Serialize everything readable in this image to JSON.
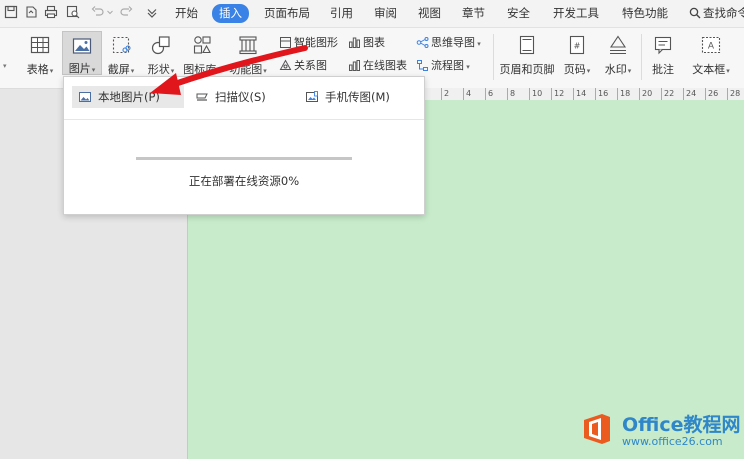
{
  "menu": {
    "tabs": [
      "开始",
      "插入",
      "页面布局",
      "引用",
      "审阅",
      "视图",
      "章节",
      "安全",
      "开发工具",
      "特色功能"
    ],
    "active_tab": "插入",
    "search_label": "查找命令"
  },
  "ribbon": {
    "table_label": "表格",
    "picture_label": "图片",
    "screenshot_label": "截屏",
    "shapes_label": "形状",
    "icons_label": "图标库",
    "function_label": "功能图",
    "smart_graphic": "智能图形",
    "chart": "图表",
    "mindmap": "思维导图",
    "relation": "关系图",
    "online_chart": "在线图表",
    "flowchart": "流程图",
    "header_footer": "页眉和页脚",
    "page_number": "页码",
    "watermark": "水印",
    "comment": "批注",
    "textbox": "文本框"
  },
  "dropdown": {
    "local_picture": "本地图片(P)",
    "scanner": "扫描仪(S)",
    "phone_picture": "手机传图(M)",
    "progress_text": "正在部署在线资源0%",
    "progress_value": 0
  },
  "ruler": {
    "labels": [
      "2",
      "4",
      "6",
      "8",
      "10",
      "12",
      "14",
      "16",
      "18",
      "20",
      "22",
      "24",
      "26",
      "28"
    ]
  },
  "watermark": {
    "title": "Office教程网",
    "url": "www.office26.com"
  },
  "colors": {
    "accent": "#3a82e5",
    "page_bg": "#c7ebcb",
    "arrow": "#e0161c",
    "watermark_orange": "#eb5a1e",
    "watermark_blue": "#2f87c9"
  }
}
